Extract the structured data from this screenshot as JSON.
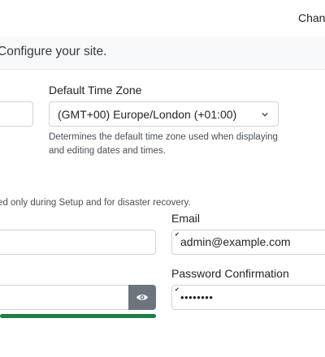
{
  "header": {
    "change_link": "Change"
  },
  "intro": {
    "text": "Configure your site."
  },
  "timezone": {
    "label": "Default Time Zone",
    "selected": "(GMT+00) Europe/London (+01:00)",
    "help_line1": "Determines the default time zone used when displaying",
    "help_line2": "and editing dates and times."
  },
  "admin_note": "Used only during Setup and for disaster recovery.",
  "email": {
    "label": "Email",
    "value": "admin@example.com"
  },
  "password_confirmation": {
    "label": "Password Confirmation",
    "value": "••••••••"
  },
  "password_strength": {
    "fraction": 1.0,
    "color": "#1e7e43"
  },
  "icons": {
    "chevron": "chevron-down-icon",
    "eye": "eye-icon",
    "check": "check-icon"
  }
}
